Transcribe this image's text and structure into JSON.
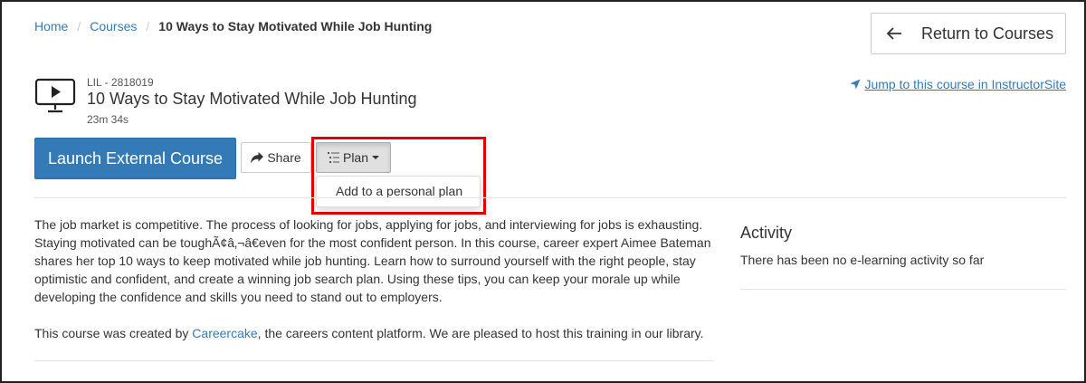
{
  "breadcrumb": {
    "items": [
      "Home",
      "Courses"
    ],
    "current": "10 Ways to Stay Motivated While Job Hunting"
  },
  "return_button": {
    "label": "Return to Courses",
    "icon": "arrow-left-icon"
  },
  "jump_link": {
    "label": "Jump to this course in InstructorSite",
    "icon": "location-arrow-icon"
  },
  "course": {
    "code": "LIL - 2818019",
    "title": "10 Ways to Stay Motivated While Job Hunting",
    "duration": "23m 34s",
    "icon": "video-monitor-icon"
  },
  "actions": {
    "launch_label": "Launch External Course",
    "share_label": "Share",
    "plan_label": "Plan",
    "plan_menu": [
      "Add to a personal plan"
    ]
  },
  "description": "The job market is competitive. The process of looking for jobs, applying for jobs, and interviewing for jobs is exhausting. Staying motivated can be toughÃ¢â‚¬â€even for the most confident person. In this course, career expert Aimee Bateman shares her top 10 ways to keep motivated while job hunting. Learn how to surround yourself with the right people, stay optimistic and confident, and create a winning job search plan. Using these tips, you can keep your morale up while developing the confidence and skills you need to stand out to employers.",
  "credit": {
    "prefix": "This course was created by ",
    "link": "Careercake",
    "suffix": ", the careers content platform. We are pleased to host this training in our library."
  },
  "activity": {
    "title": "Activity",
    "text": "There has been no e-learning activity so far"
  },
  "colors": {
    "primary": "#337ab7",
    "highlight": "#e00000"
  }
}
